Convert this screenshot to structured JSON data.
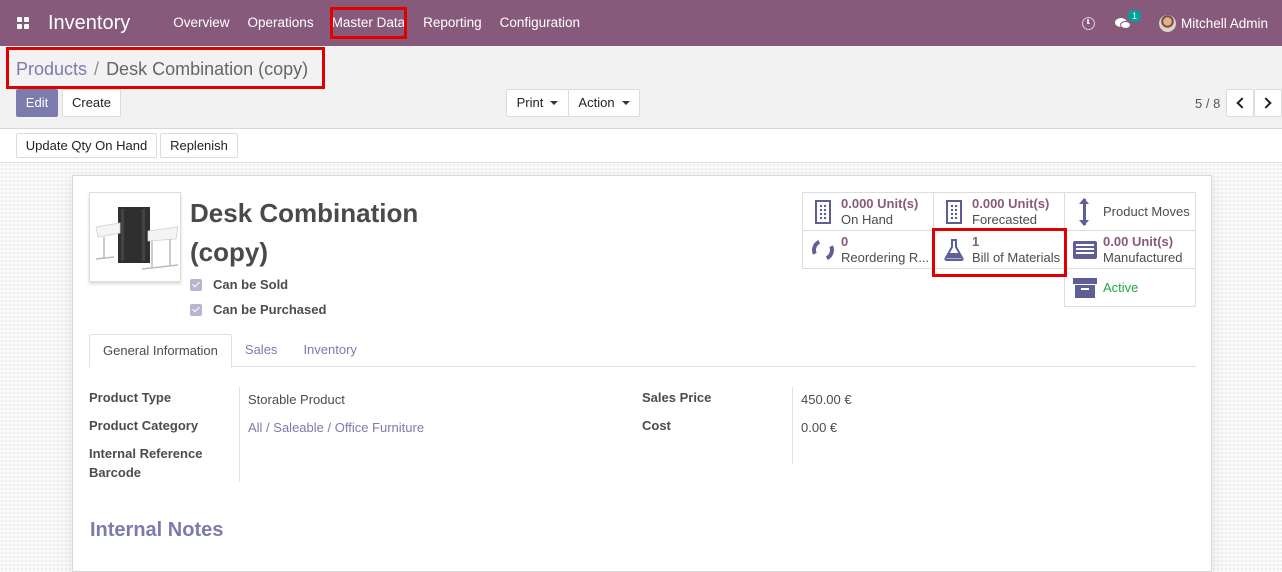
{
  "navbar": {
    "brand": "Inventory",
    "menu": [
      "Overview",
      "Operations",
      "Master Data",
      "Reporting",
      "Configuration"
    ],
    "chat_count": "1",
    "user": "Mitchell Admin"
  },
  "breadcrumb": {
    "parent": "Products",
    "separator": "/",
    "current": "Desk Combination (copy)"
  },
  "toolbar": {
    "edit": "Edit",
    "create": "Create",
    "print": "Print",
    "action": "Action",
    "pager": "5 / 8"
  },
  "statusbar": {
    "update_qty": "Update Qty On Hand",
    "replenish": "Replenish"
  },
  "product": {
    "name_line1": "Desk Combination",
    "name_line2": "(copy)",
    "can_be_sold": "Can be Sold",
    "can_be_purchased": "Can be Purchased"
  },
  "smart_buttons": {
    "on_hand": {
      "value": "0.000",
      "unit": "Unit(s)",
      "label": "On Hand"
    },
    "forecasted": {
      "value": "0.000",
      "unit": "Unit(s)",
      "label": "Forecasted"
    },
    "product_moves": {
      "label": "Product Moves"
    },
    "reordering": {
      "value": "0",
      "label": "Reordering R..."
    },
    "bom": {
      "value": "1",
      "label": "Bill of Materials"
    },
    "manufactured": {
      "value": "0.00",
      "unit": "Unit(s)",
      "label": "Manufactured"
    },
    "active": {
      "label": "Active"
    }
  },
  "tabs": [
    "General Information",
    "Sales",
    "Inventory"
  ],
  "fields": {
    "product_type": {
      "label": "Product Type",
      "value": "Storable Product"
    },
    "product_category": {
      "label": "Product Category",
      "value": "All / Saleable / Office Furniture"
    },
    "internal_reference": {
      "label": "Internal Reference"
    },
    "barcode": {
      "label": "Barcode"
    },
    "sales_price": {
      "label": "Sales Price",
      "value": "450.00 €"
    },
    "cost": {
      "label": "Cost",
      "value": "0.00 €"
    }
  },
  "internal_notes": "Internal Notes",
  "colors": {
    "brand": "#875a7b",
    "primary": "#7c7bad",
    "icon": "#5f5e97",
    "active": "#28a745",
    "highlight": "#e00000"
  }
}
